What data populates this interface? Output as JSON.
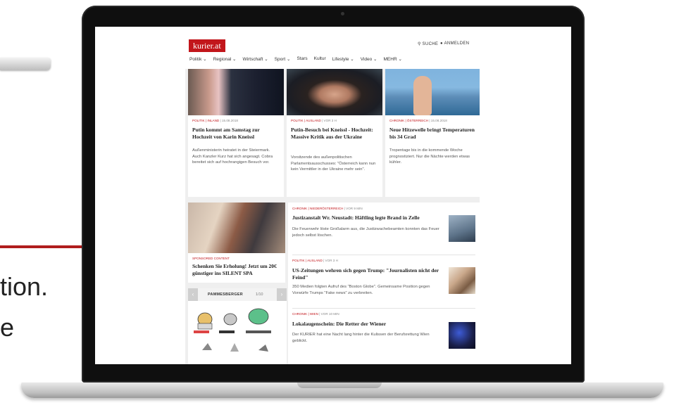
{
  "slide": {
    "text_line1": "tion.",
    "text_line2": "e"
  },
  "site": {
    "logo": "kurier.at",
    "search_label": "SUCHE",
    "login_label": "ANMELDEN",
    "nav": [
      "Politik ⌄",
      "Regional ⌄",
      "Wirtschaft ⌄",
      "Sport ⌄",
      "Stars",
      "Kultur",
      "Lifestyle ⌄",
      "Video ⌄",
      "MEHR ⌄"
    ],
    "top_articles": [
      {
        "section": "POLITIK | INLAND",
        "date": " | 15.08.2018",
        "headline": "Putin kommt am Samstag zur Hochzeit von Karin Kneissl",
        "teaser": "Außenministerin heiratet in der Steiermark. Auch Kanzler Kurz hat sich angesagt. Cobra bereitet sich auf hochrangigen Besuch vor."
      },
      {
        "section": "POLITIK | AUSLAND",
        "date": " | vor 3 h",
        "headline": "Putin-Besuch bei Kneissl - Hochzeit: Massive Kritik aus der Ukraine",
        "teaser": "Vorsitzende des außenpolitischen Parlamentsausschusses: \"Österreich kann nun kein Vermittler in der Ukraine mehr sein\"."
      },
      {
        "section": "CHRONIK | ÖSTERREICH",
        "date": " | 15.08.2018",
        "headline": "Neue Hitzewelle bringt Temperaturen bis 34 Grad",
        "teaser": "Tropentage bis in die kommende Woche prognostiziert. Nur die Nächte werden etwas kühler."
      }
    ],
    "sponsored": {
      "label": "SPONSORED CONTENT",
      "headline": "Schenken Sie Erholung! Jetzt um 20€ günstiger ins SILENT SPA"
    },
    "paper": {
      "title": "PAMMESBERGER",
      "count": "1/10",
      "prev": "‹",
      "next": "›"
    },
    "list_articles": [
      {
        "section": "CHRONIK | NIEDERÖSTERREICH",
        "date": " | vor 9 min",
        "headline": "Justizanstalt Wr. Neustadt: Häftling legte Brand in Zelle",
        "teaser": "Die Feuerwehr löste Großalarm aus, die Justizwachebeamten konnten das Feuer jedoch selbst löschen."
      },
      {
        "section": "POLITIK | AUSLAND",
        "date": " | vor 3 h",
        "headline": "US-Zeitungen wehren sich gegen Trump: \"Journalisten nicht der Feind\"",
        "teaser": "350 Medien folgten Aufruf des \"Boston Globe\". Gemeinsame Position gegen Vorwürfe Trumps \"Fake news\" zu verbreiten."
      },
      {
        "section": "CHRONIK | WIEN",
        "date": " | vor 10 min",
        "headline": "Lokalaugenschein: Die Retter der Wiener",
        "teaser": "Der KURIER hat eine Nacht lang hinter die Kulissen der Berufsrettung Wien geblickt."
      }
    ]
  },
  "colors": {
    "accent": "#c2161b",
    "annotation": "#b01d1d"
  }
}
